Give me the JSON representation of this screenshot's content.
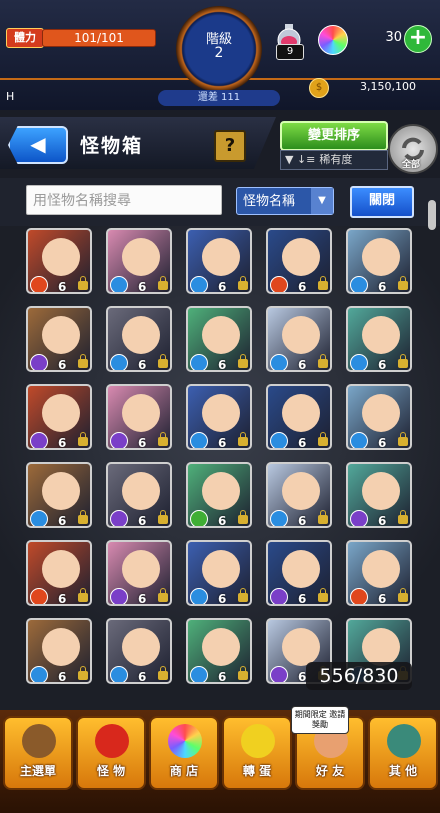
{
  "status_bar": {
    "stamina_label": "體力",
    "stamina_value": "101/101",
    "stamina_fill": 1.0,
    "rank_title": "階級",
    "rank_value": "2",
    "rank_diff": "還差 111",
    "potion_count": "9",
    "orb_count": "30",
    "money": "3,150,100",
    "coin_symbol": "$",
    "h_label": "H"
  },
  "header": {
    "back_icon": "◀",
    "title": "怪物箱",
    "help": "?",
    "sort_button": "變更排序",
    "sort_mode": "稀有度",
    "filter_label": "全部"
  },
  "search": {
    "placeholder": "用怪物名稱搜尋",
    "mode": "怪物名稱",
    "mode_arrow": "▼",
    "close_button": "關閉"
  },
  "monster_grid": {
    "count_text": "556/830",
    "rows": [
      [
        "fire",
        "water",
        "water",
        "fire",
        "water"
      ],
      [
        "dark",
        "water",
        "water",
        "water",
        "water"
      ],
      [
        "dark",
        "dark",
        "water",
        "water",
        "water"
      ],
      [
        "water",
        "dark",
        "wood",
        "water",
        "dark"
      ],
      [
        "fire",
        "dark",
        "water",
        "dark",
        "fire"
      ],
      [
        "water",
        "water",
        "water",
        "dark",
        "water"
      ]
    ],
    "levels": "6",
    "element_colors": {
      "fire": "#e0471d",
      "water": "#2a8de0",
      "wood": "#3fae34",
      "dark": "#7a3fc8",
      "light": "#f0c830"
    }
  },
  "bottom_nav": {
    "items": [
      {
        "label": "主選單",
        "icon": "house-icon"
      },
      {
        "label": "怪 物",
        "icon": "monster-icon"
      },
      {
        "label": "商 店",
        "icon": "orb-icon"
      },
      {
        "label": "轉 蛋",
        "icon": "egg-icon"
      },
      {
        "label": "好 友",
        "icon": "friend-icon"
      },
      {
        "label": "其 他",
        "icon": "question-icon"
      }
    ],
    "limited_badge": "期間限定 邀請獎勵"
  },
  "colors": {
    "accent": "#f3a433",
    "nav": "#ffbe2e",
    "sort_green": "#2c8e1c",
    "blue": "#1550c9"
  }
}
